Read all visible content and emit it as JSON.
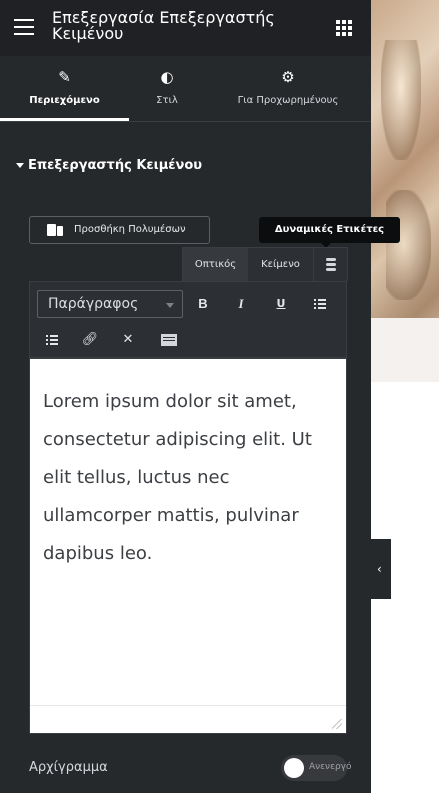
{
  "header": {
    "title": "Επεξεργασία Επεξεργαστής Κειμένου",
    "menu_icon": "hamburger-icon",
    "apps_icon": "grid-icon"
  },
  "tabs": [
    {
      "label": "Περιεχόμενο",
      "icon": "pencil-icon",
      "active": true
    },
    {
      "label": "Στιλ",
      "icon": "half-circle-icon",
      "active": false
    },
    {
      "label": "Για Προχωρημένους",
      "icon": "gear-icon",
      "active": false
    }
  ],
  "section": {
    "title": "Επεξεργαστής Κειμένου",
    "collapsed": false
  },
  "editor": {
    "add_media_label": "Προσθήκη Πολυμέσων",
    "dynamic_tags_tooltip": "Δυναμικές Ετικέτες",
    "mode_visual": "Οπτικός",
    "mode_text": "Κείμενο",
    "format_value": "Παράγραφος",
    "toolbar_bold": "B",
    "toolbar_italic": "I",
    "toolbar_underline": "U",
    "content": "Lorem ipsum dolor sit amet, consectetur adipiscing elit. Ut elit tellus, luctus nec ullamcorper mattis, pulvinar dapibus leo."
  },
  "drop_cap": {
    "label": "Αρχίγραμμα",
    "state": "Ανενεργό",
    "enabled": false
  },
  "colors": {
    "panel_bg": "#26292c",
    "header_bg": "#1f2124",
    "editor_bg": "#ffffff",
    "text_dark": "#3c3f43"
  }
}
